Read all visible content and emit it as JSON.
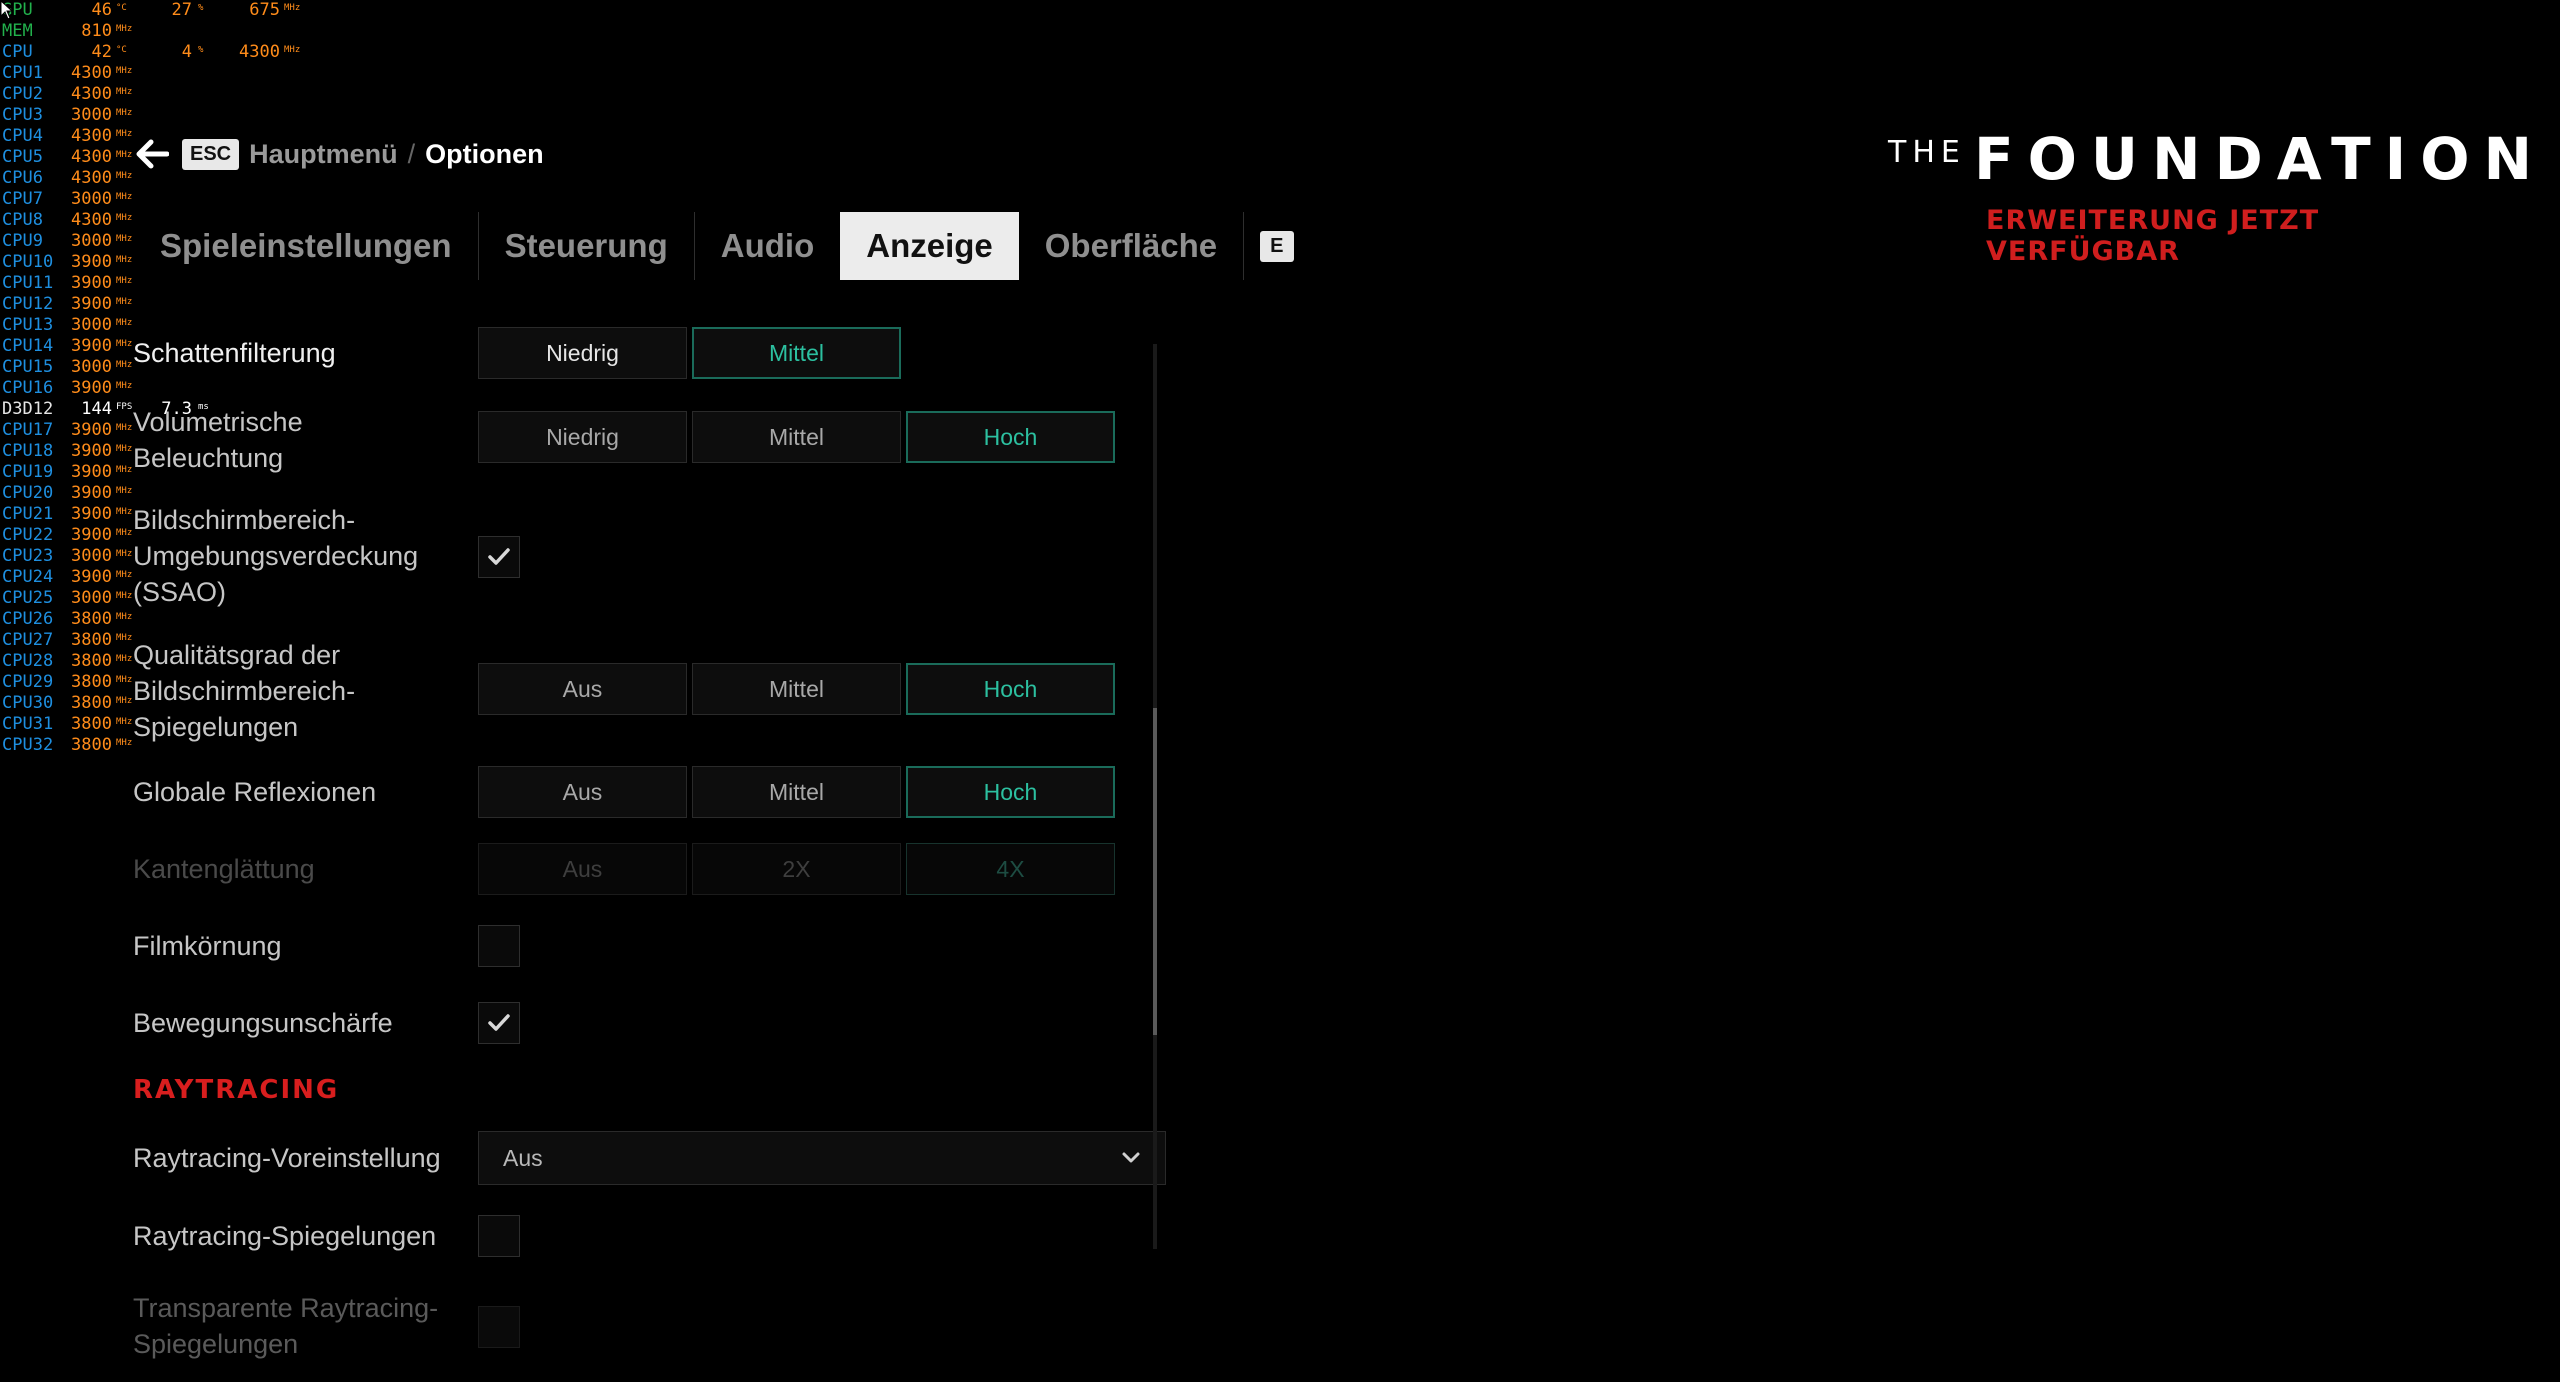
{
  "osd": {
    "rows": [
      {
        "label": "GPU",
        "kind": "gpu",
        "v1": "46",
        "u1": "°C",
        "v2": "27",
        "u2": "%",
        "v3": "675",
        "u3": "MHz"
      },
      {
        "label": "MEM",
        "kind": "mem",
        "v1": "810",
        "u1": "MHz"
      },
      {
        "label": "CPU",
        "kind": "cpu",
        "v1": "42",
        "u1": "°C",
        "v2": "4",
        "u2": "%",
        "v3": "4300",
        "u3": "MHz"
      },
      {
        "label": "CPU1",
        "kind": "cpu",
        "v1": "4300",
        "u1": "MHz"
      },
      {
        "label": "CPU2",
        "kind": "cpu",
        "v1": "4300",
        "u1": "MHz"
      },
      {
        "label": "CPU3",
        "kind": "cpu",
        "v1": "3000",
        "u1": "MHz"
      },
      {
        "label": "CPU4",
        "kind": "cpu",
        "v1": "4300",
        "u1": "MHz"
      },
      {
        "label": "CPU5",
        "kind": "cpu",
        "v1": "4300",
        "u1": "MHz"
      },
      {
        "label": "CPU6",
        "kind": "cpu",
        "v1": "4300",
        "u1": "MHz"
      },
      {
        "label": "CPU7",
        "kind": "cpu",
        "v1": "3000",
        "u1": "MHz"
      },
      {
        "label": "CPU8",
        "kind": "cpu",
        "v1": "4300",
        "u1": "MHz"
      },
      {
        "label": "CPU9",
        "kind": "cpu",
        "v1": "3000",
        "u1": "MHz"
      },
      {
        "label": "CPU10",
        "kind": "cpu",
        "v1": "3900",
        "u1": "MHz"
      },
      {
        "label": "CPU11",
        "kind": "cpu",
        "v1": "3900",
        "u1": "MHz"
      },
      {
        "label": "CPU12",
        "kind": "cpu",
        "v1": "3900",
        "u1": "MHz"
      },
      {
        "label": "CPU13",
        "kind": "cpu",
        "v1": "3000",
        "u1": "MHz"
      },
      {
        "label": "CPU14",
        "kind": "cpu",
        "v1": "3900",
        "u1": "MHz"
      },
      {
        "label": "CPU15",
        "kind": "cpu",
        "v1": "3000",
        "u1": "MHz"
      },
      {
        "label": "CPU16",
        "kind": "cpu",
        "v1": "3900",
        "u1": "MHz"
      },
      {
        "label": "D3D12",
        "kind": "d3d",
        "v1": "144",
        "u1": "FPS",
        "v2": "7.3",
        "u2": "ms"
      },
      {
        "label": "CPU17",
        "kind": "cpu",
        "v1": "3900",
        "u1": "MHz"
      },
      {
        "label": "CPU18",
        "kind": "cpu",
        "v1": "3900",
        "u1": "MHz"
      },
      {
        "label": "CPU19",
        "kind": "cpu",
        "v1": "3900",
        "u1": "MHz"
      },
      {
        "label": "CPU20",
        "kind": "cpu",
        "v1": "3900",
        "u1": "MHz"
      },
      {
        "label": "CPU21",
        "kind": "cpu",
        "v1": "3900",
        "u1": "MHz"
      },
      {
        "label": "CPU22",
        "kind": "cpu",
        "v1": "3900",
        "u1": "MHz"
      },
      {
        "label": "CPU23",
        "kind": "cpu",
        "v1": "3000",
        "u1": "MHz"
      },
      {
        "label": "CPU24",
        "kind": "cpu",
        "v1": "3900",
        "u1": "MHz"
      },
      {
        "label": "CPU25",
        "kind": "cpu",
        "v1": "3000",
        "u1": "MHz"
      },
      {
        "label": "CPU26",
        "kind": "cpu",
        "v1": "3800",
        "u1": "MHz"
      },
      {
        "label": "CPU27",
        "kind": "cpu",
        "v1": "3800",
        "u1": "MHz"
      },
      {
        "label": "CPU28",
        "kind": "cpu",
        "v1": "3800",
        "u1": "MHz"
      },
      {
        "label": "CPU29",
        "kind": "cpu",
        "v1": "3800",
        "u1": "MHz"
      },
      {
        "label": "CPU30",
        "kind": "cpu",
        "v1": "3800",
        "u1": "MHz"
      },
      {
        "label": "CPU31",
        "kind": "cpu",
        "v1": "3800",
        "u1": "MHz"
      },
      {
        "label": "CPU32",
        "kind": "cpu",
        "v1": "3800",
        "u1": "MHz"
      }
    ]
  },
  "header": {
    "esc_key": "ESC",
    "breadcrumb_main": "Hauptmenü",
    "breadcrumb_sep": "/",
    "breadcrumb_current": "Optionen"
  },
  "tabs": {
    "items": [
      "Spieleinstellungen",
      "Steuerung",
      "Audio",
      "Anzeige",
      "Oberfläche"
    ],
    "active": "Anzeige",
    "next_key": "E"
  },
  "settings": {
    "shadow_filter": {
      "label": "Schattenfilterung",
      "options": [
        "Niedrig",
        "Mittel"
      ],
      "selected": "Mittel"
    },
    "volumetric": {
      "label_line1": "Volumetrische",
      "label_line2": "Beleuchtung",
      "options": [
        "Niedrig",
        "Mittel",
        "Hoch"
      ],
      "selected": "Hoch"
    },
    "ssao": {
      "label_line1": "Bildschirmbereich-",
      "label_line2": "Umgebungsverdeckung",
      "label_line3": "(SSAO)",
      "checked": true
    },
    "ssr_quality": {
      "label_line1": "Qualitätsgrad der",
      "label_line2": "Bildschirmbereich-",
      "label_line3": "Spiegelungen",
      "options": [
        "Aus",
        "Mittel",
        "Hoch"
      ],
      "selected": "Hoch"
    },
    "global_reflections": {
      "label": "Globale Reflexionen",
      "options": [
        "Aus",
        "Mittel",
        "Hoch"
      ],
      "selected": "Hoch"
    },
    "antialiasing": {
      "label": "Kantenglättung",
      "options": [
        "Aus",
        "2X",
        "4X"
      ],
      "selected": "4X",
      "disabled": true
    },
    "film_grain": {
      "label": "Filmkörnung",
      "checked": false
    },
    "motion_blur": {
      "label": "Bewegungsunschärfe",
      "checked": true
    },
    "raytracing_section": "RAYTRACING",
    "rt_preset": {
      "label": "Raytracing-Voreinstellung",
      "value": "Aus"
    },
    "rt_reflections": {
      "label": "Raytracing-Spiegelungen",
      "checked": false
    },
    "rt_transparent": {
      "label_line1": "Transparente Raytracing-",
      "label_line2": "Spiegelungen",
      "checked": false,
      "disabled": true
    }
  },
  "logo": {
    "the": "THE",
    "name": "FOUNDATION",
    "tagline": "ERWEITERUNG JETZT VERFÜGBAR"
  },
  "colors": {
    "accent_teal": "#2cc0a0",
    "accent_red": "#d81e1e",
    "osd_orange": "#ff8c1a",
    "osd_blue": "#1e8fe0"
  }
}
